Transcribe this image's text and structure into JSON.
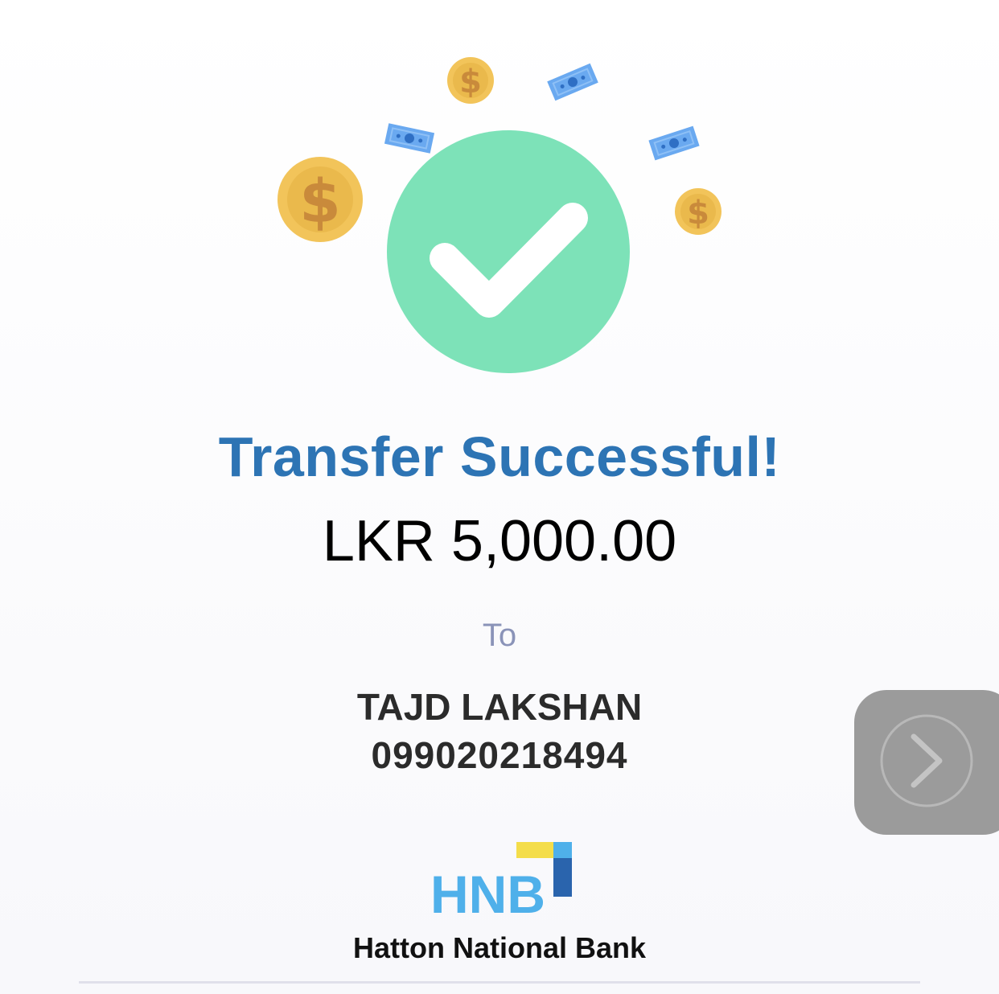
{
  "status": {
    "title": "Transfer Successful!",
    "amount": "LKR 5,000.00",
    "to_label": "To"
  },
  "recipient": {
    "name": "TAJD LAKSHAN",
    "account": "099020218494"
  },
  "bank": {
    "logo_text": "HNB",
    "name": "Hatton National Bank"
  },
  "colors": {
    "success_green": "#7de2b8",
    "title_blue": "#2d74b4",
    "coin_gold": "#f2c45a",
    "note_blue": "#6aa9f0",
    "logo_light_blue": "#4fb0ea",
    "logo_yellow": "#f4dd4a",
    "logo_dark_blue": "#2a64ad",
    "button_gray": "#9b9b9b"
  },
  "icons": {
    "success": "check-circle-icon",
    "coin": "dollar-coin-icon",
    "banknote": "banknote-icon",
    "next": "chevron-right-icon"
  }
}
